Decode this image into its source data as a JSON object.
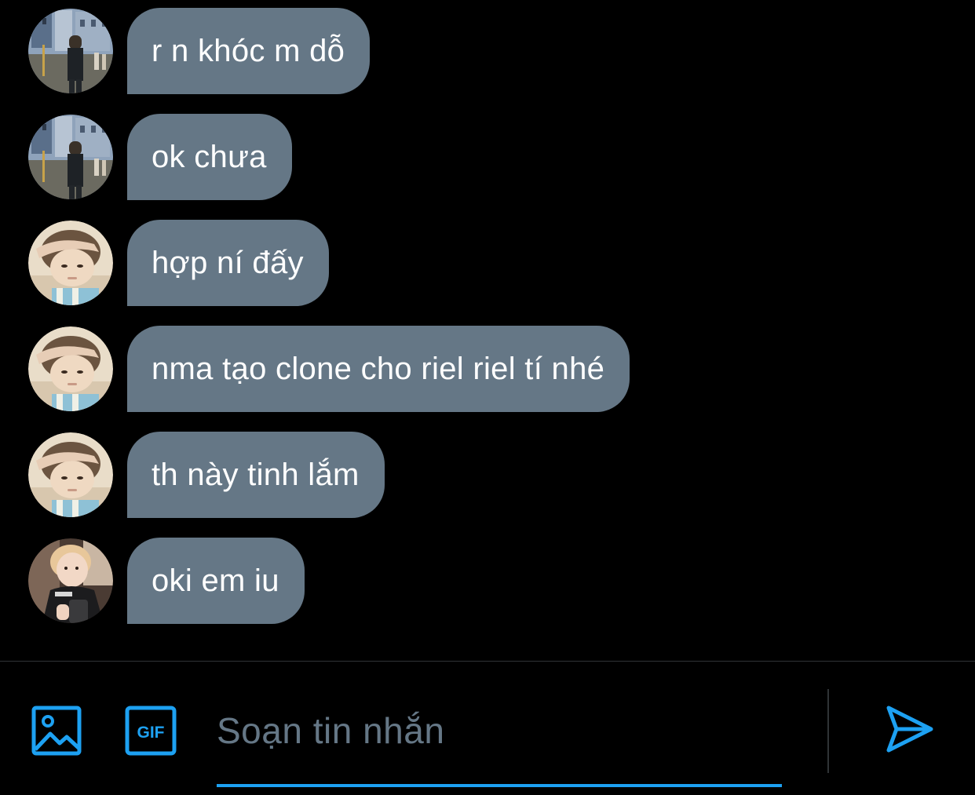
{
  "messages": [
    {
      "text": "r n khóc m dỗ",
      "avatar": "avatar-street-photo"
    },
    {
      "text": "ok chưa",
      "avatar": "avatar-street-photo"
    },
    {
      "text": "hợp ní đấy",
      "avatar": "avatar-boy-lying-down"
    },
    {
      "text": "nma tạo clone cho riel riel tí nhé",
      "avatar": "avatar-boy-lying-down"
    },
    {
      "text": "th này tinh lắm",
      "avatar": "avatar-boy-lying-down"
    },
    {
      "text": "oki em iu",
      "avatar": "avatar-boy-selfie"
    }
  ],
  "composer": {
    "placeholder": "Soạn tin nhắn",
    "value": "",
    "media_icon": "image-icon",
    "gif_icon": "gif-icon",
    "gif_label": "GIF",
    "send_icon": "send-icon"
  },
  "colors": {
    "background": "#000000",
    "bubble": "#657786",
    "accent": "#1da1f2",
    "placeholder": "#657786",
    "divider": "#2f3336"
  }
}
